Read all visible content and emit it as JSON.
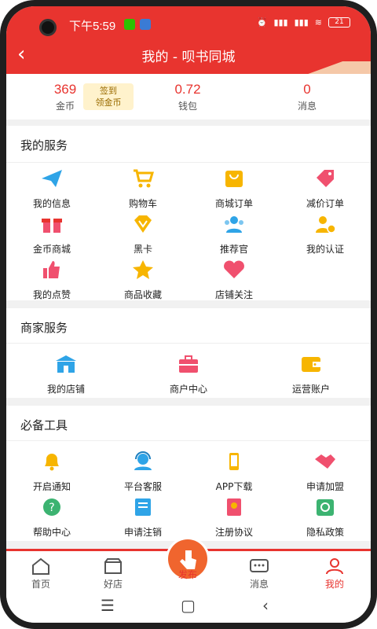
{
  "status": {
    "time": "下午5:59",
    "battery": "21"
  },
  "header": {
    "back": "‹",
    "title": "我的 - 呗书同城"
  },
  "stats": {
    "coins_value": "369",
    "coins_label": "金币",
    "checkin_line1": "签到",
    "checkin_line2": "领金币",
    "wallet_value": "0.72",
    "wallet_label": "钱包",
    "msg_value": "0",
    "msg_label": "消息"
  },
  "my_services": {
    "title": "我的服务",
    "items": [
      "我的信息",
      "购物车",
      "商城订单",
      "减价订单",
      "金币商城",
      "黑卡",
      "推荐官",
      "我的认证",
      "我的点赞",
      "商品收藏",
      "店铺关注"
    ]
  },
  "merchant_services": {
    "title": "商家服务",
    "items": [
      "我的店铺",
      "商户中心",
      "运营账户"
    ]
  },
  "tools": {
    "title": "必备工具",
    "items": [
      "开启通知",
      "平台客服",
      "APP下载",
      "申请加盟",
      "帮助中心",
      "申请注销",
      "注册协议",
      "隐私政策"
    ]
  },
  "tabbar": {
    "home": "首页",
    "shop": "好店",
    "publish": "发布",
    "messages": "消息",
    "mine": "我的"
  },
  "colors": {
    "brand": "#e8342f",
    "icon_blue": "#2fa4e7",
    "icon_yellow": "#f7b500",
    "icon_pink": "#f0506e"
  }
}
